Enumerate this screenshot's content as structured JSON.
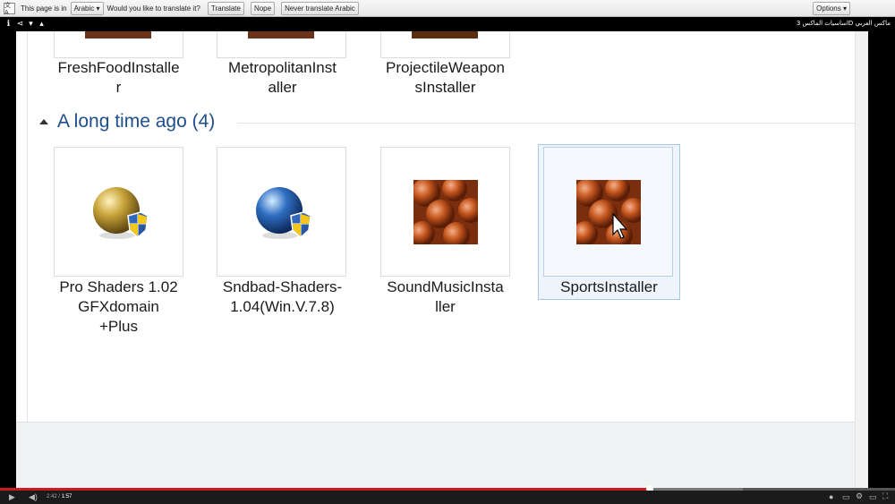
{
  "translate_bar": {
    "prefix": "This page is in",
    "language": "Arabic",
    "question": "Would you like to translate it?",
    "translate": "Translate",
    "nope": "Nope",
    "never": "Never translate Arabic",
    "options": "Options"
  },
  "video": {
    "title": "اساسيات الماكس 3D ماكس العربي",
    "current_time": "2:42",
    "separator": "/",
    "duration": "1:57",
    "progress_fraction": 0.726,
    "buffered_fraction": 0.83
  },
  "explorer": {
    "top_row": [
      {
        "line1": "FreshFoodInstalle",
        "line2": "r"
      },
      {
        "line1": "MetropolitanInst",
        "line2": "aller"
      },
      {
        "line1": "ProjectileWeapon",
        "line2": "sInstaller"
      }
    ],
    "group": {
      "title": "A long time ago (4)"
    },
    "items": [
      {
        "line1": "Pro Shaders 1.02",
        "line2": "GFXdomain",
        "line3": "+Plus"
      },
      {
        "line1": "Sndbad-Shaders-",
        "line2": "1.04(Win.V.7.8)",
        "line3": ""
      },
      {
        "line1": "SoundMusicInsta",
        "line2": "ller",
        "line3": ""
      },
      {
        "line1": "SportsInstaller",
        "line2": "",
        "line3": ""
      }
    ]
  },
  "colors": {
    "group_title": "#1e4e8c",
    "progress_played": "#cc181e",
    "selection": "#eef4fb"
  }
}
